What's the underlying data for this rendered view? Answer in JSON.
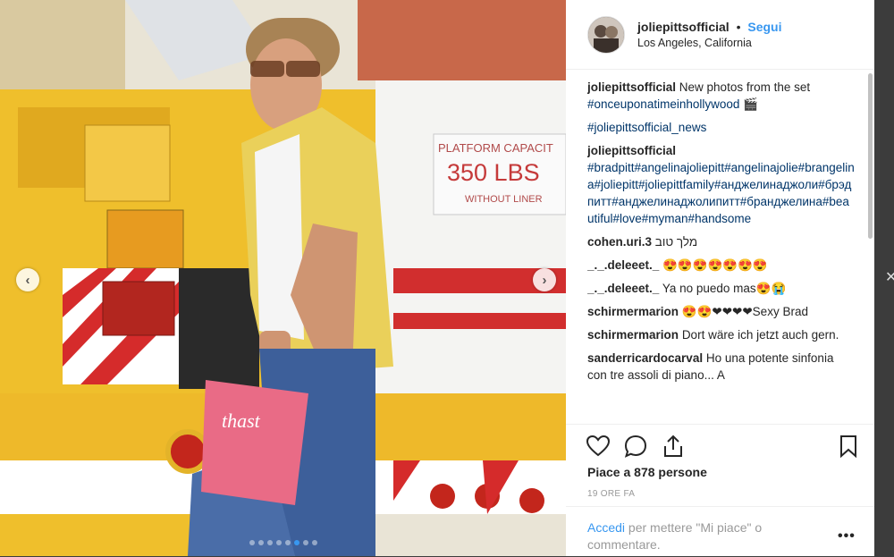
{
  "post": {
    "username": "joliepittsofficial",
    "separator": "•",
    "follow_label": "Segui",
    "location": "Los Angeles, California"
  },
  "photo": {
    "sign_line1": "PLATFORM CAPACIT",
    "sign_line2": "350 LBS",
    "sign_line3": "WITHOUT LINER",
    "bag_text": "thast",
    "slide_count": 8,
    "active_slide": 5
  },
  "comments": [
    {
      "user": "joliepittsofficial",
      "text": "New photos from the set ",
      "tags": "#onceuponatimeinhollywood 🎬"
    },
    {
      "user": "",
      "text": "",
      "tags": "#joliepittsofficial_news"
    },
    {
      "user": "joliepittsofficial",
      "text": "",
      "tags": "#bradpitt#angelinajoliepitt#angelinajolie#brangelina#joliepitt#joliepittfamily#анджелинаджоли#брэдпитт#анджелинаджолипитт#бранджелина#beautiful#love#myman#handsome"
    },
    {
      "user": "cohen.uri.3",
      "text": "מלך טוב",
      "tags": ""
    },
    {
      "user": "_._.deleeet._",
      "text": "😍😍😍😍😍😍😍",
      "tags": ""
    },
    {
      "user": "_._.deleeet._",
      "text": "Ya no puedo mas😍😭",
      "tags": ""
    },
    {
      "user": "schirmermarion",
      "text": "😍😍❤❤❤❤Sexy Brad",
      "tags": ""
    },
    {
      "user": "schirmermarion",
      "text": "Dort wäre ich jetzt auch gern.",
      "tags": ""
    },
    {
      "user": "sanderricardocarval",
      "text": "Ho una potente sinfonia con tre assoli di piano... A",
      "tags": ""
    }
  ],
  "likes": "Piace a 878 persone",
  "timestamp": "19 ORE FA",
  "login": {
    "link": "Accedi",
    "text": " per mettere \"Mi piace\" o commentare."
  },
  "more_label": "•••",
  "nav": {
    "prev": "‹",
    "next": "›"
  },
  "colors": {
    "link": "#3897f0",
    "text": "#262626",
    "muted": "#999999",
    "hashtag": "#003569"
  }
}
